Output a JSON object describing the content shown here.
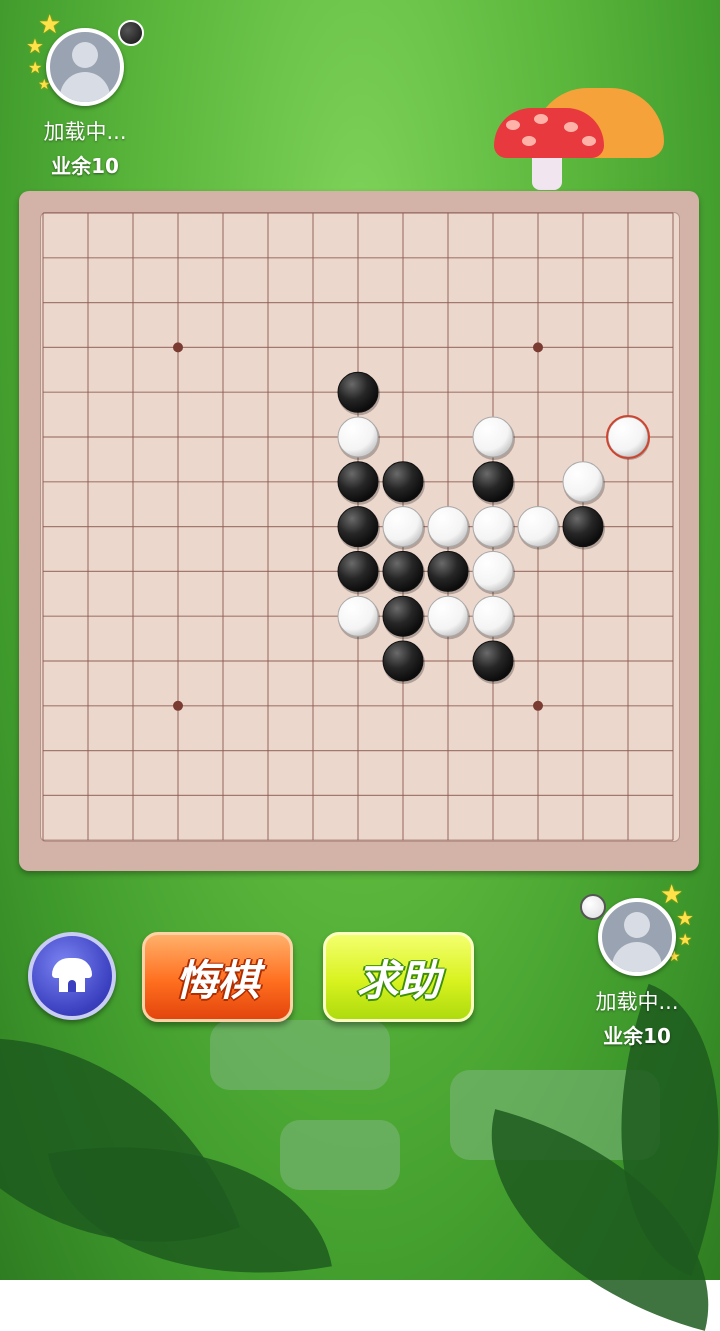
{
  "player_top": {
    "name": "加载中...",
    "level": "业余10",
    "stone": "black"
  },
  "player_bottom": {
    "name": "加载中...",
    "level": "业余10",
    "stone": "white"
  },
  "buttons": {
    "home_icon": "home-icon",
    "regret_label": "悔棋",
    "help_label": "求助"
  },
  "board": {
    "size": 15,
    "star_points": [
      [
        3,
        3
      ],
      [
        3,
        11
      ],
      [
        11,
        3
      ],
      [
        11,
        11
      ]
    ],
    "last_move": [
      5,
      13
    ],
    "stones": [
      {
        "row": 4,
        "col": 7,
        "color": "black"
      },
      {
        "row": 5,
        "col": 7,
        "color": "white"
      },
      {
        "row": 5,
        "col": 10,
        "color": "white"
      },
      {
        "row": 5,
        "col": 13,
        "color": "white"
      },
      {
        "row": 6,
        "col": 7,
        "color": "black"
      },
      {
        "row": 6,
        "col": 8,
        "color": "black"
      },
      {
        "row": 6,
        "col": 10,
        "color": "black"
      },
      {
        "row": 6,
        "col": 12,
        "color": "white"
      },
      {
        "row": 7,
        "col": 7,
        "color": "black"
      },
      {
        "row": 7,
        "col": 8,
        "color": "white"
      },
      {
        "row": 7,
        "col": 9,
        "color": "white"
      },
      {
        "row": 7,
        "col": 10,
        "color": "white"
      },
      {
        "row": 7,
        "col": 11,
        "color": "white"
      },
      {
        "row": 7,
        "col": 12,
        "color": "black"
      },
      {
        "row": 8,
        "col": 7,
        "color": "black"
      },
      {
        "row": 8,
        "col": 8,
        "color": "black"
      },
      {
        "row": 8,
        "col": 9,
        "color": "black"
      },
      {
        "row": 8,
        "col": 10,
        "color": "white"
      },
      {
        "row": 9,
        "col": 7,
        "color": "white"
      },
      {
        "row": 9,
        "col": 8,
        "color": "black"
      },
      {
        "row": 9,
        "col": 9,
        "color": "white"
      },
      {
        "row": 9,
        "col": 10,
        "color": "white"
      },
      {
        "row": 10,
        "col": 8,
        "color": "black"
      },
      {
        "row": 10,
        "col": 10,
        "color": "black"
      }
    ]
  },
  "colors": {
    "board": "#ecd7cc",
    "grid": "#8a5a52",
    "last_move_ring": "#d0432f"
  }
}
